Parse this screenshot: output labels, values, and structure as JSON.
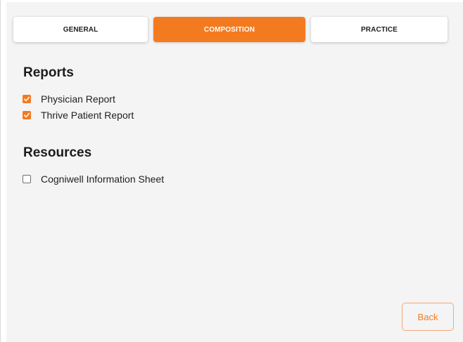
{
  "tabs": [
    {
      "id": "general",
      "label": "GENERAL",
      "active": false
    },
    {
      "id": "composition",
      "label": "COMPOSITION",
      "active": true
    },
    {
      "id": "practice",
      "label": "PRACTICE",
      "active": false
    }
  ],
  "reports": {
    "title": "Reports",
    "items": [
      {
        "label": "Physician Report",
        "checked": true
      },
      {
        "label": "Thrive Patient Report",
        "checked": true
      }
    ]
  },
  "resources": {
    "title": "Resources",
    "items": [
      {
        "label": "Cogniwell Information Sheet",
        "checked": false
      }
    ]
  },
  "back_label": "Back",
  "colors": {
    "accent": "#f47a20",
    "button_border": "#f4a878",
    "text": "#1f1f1f",
    "panel_bg": "#f4f4f4"
  },
  "icons": {
    "checkbox_checked": "checkmark-icon"
  }
}
